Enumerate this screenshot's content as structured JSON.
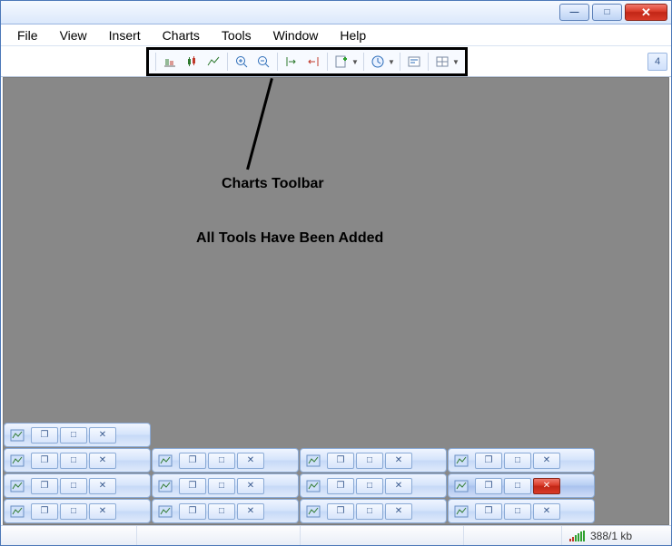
{
  "titlebar": {
    "minimize_glyph": "—",
    "maximize_glyph": "□",
    "close_glyph": "✕"
  },
  "menu": {
    "items": [
      "File",
      "View",
      "Insert",
      "Charts",
      "Tools",
      "Window",
      "Help"
    ]
  },
  "toolbar": {
    "badge_value": "4"
  },
  "annotations": {
    "label1": "Charts Toolbar",
    "label2": "All Tools Have Been Added"
  },
  "mdi": {
    "restore_glyph": "❐",
    "maximize_glyph": "□",
    "close_glyph": "✕"
  },
  "status": {
    "traffic": "388/1 kb"
  }
}
